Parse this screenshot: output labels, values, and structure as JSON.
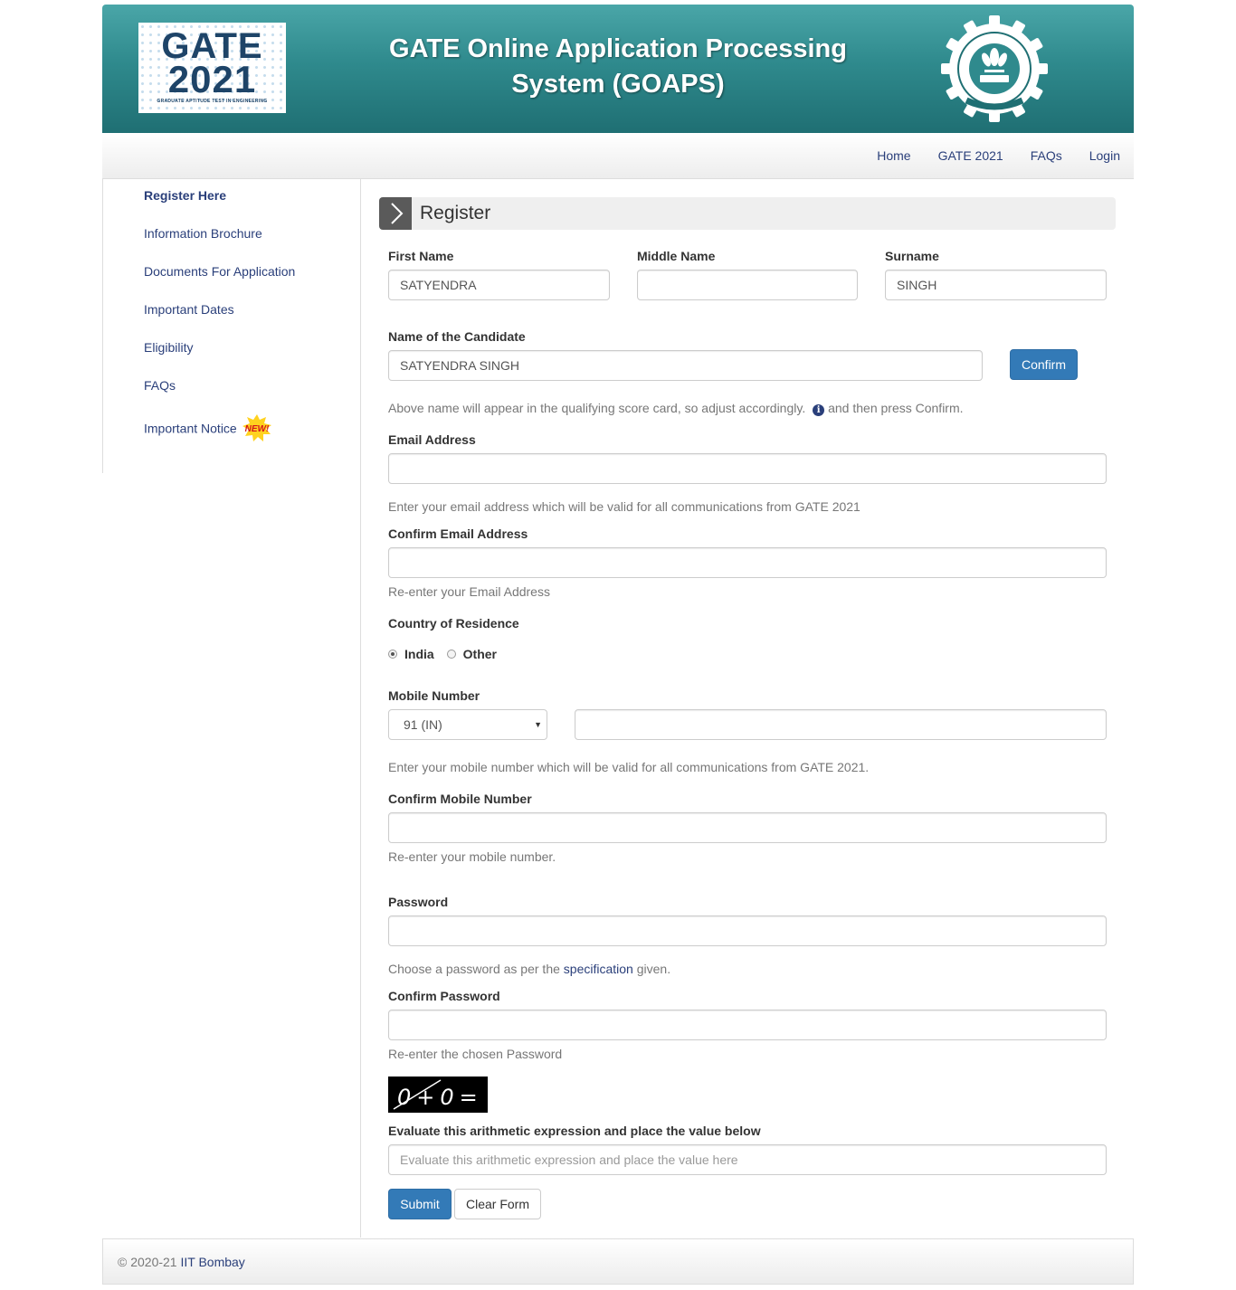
{
  "header": {
    "logo_line1": "GATE",
    "logo_line2": "2021",
    "logo_tagline": "GRADUATE APTITUDE TEST IN ENGINEERING",
    "title_line1": "GATE Online Application Processing",
    "title_line2": "System (GOAPS)"
  },
  "nav": {
    "home": "Home",
    "gate2021": "GATE 2021",
    "faqs": "FAQs",
    "login": "Login"
  },
  "sidebar": {
    "items": [
      "Register Here",
      "Information Brochure",
      "Documents For Application",
      "Important Dates",
      "Eligibility",
      "FAQs",
      "Important Notice"
    ],
    "new_badge": "NEW!"
  },
  "form": {
    "title": "Register",
    "first_name": {
      "label": "First Name",
      "value": "SATYENDRA"
    },
    "middle_name": {
      "label": "Middle Name",
      "value": ""
    },
    "surname": {
      "label": "Surname",
      "value": "SINGH"
    },
    "candidate_name": {
      "label": "Name of the Candidate",
      "value": "SATYENDRA SINGH"
    },
    "confirm_button": "Confirm",
    "name_help_1": "Above name will appear in the qualifying score card, so adjust accordingly.",
    "name_help_2": "and then press Confirm.",
    "email": {
      "label": "Email Address",
      "value": "",
      "help": "Enter your email address which will be valid for all communications from GATE 2021"
    },
    "confirm_email": {
      "label": "Confirm Email Address",
      "value": "",
      "help": "Re-enter your Email Address"
    },
    "country": {
      "label": "Country of Residence",
      "options": [
        "India",
        "Other"
      ],
      "selected": "India"
    },
    "mobile": {
      "label": "Mobile Number",
      "code": "91 (IN)",
      "value": "",
      "help": "Enter your mobile number which will be valid for all communications from GATE 2021."
    },
    "confirm_mobile": {
      "label": "Confirm Mobile Number",
      "value": "",
      "help": "Re-enter your mobile number."
    },
    "password": {
      "label": "Password",
      "help_1": "Choose a password as per the",
      "help_link": "specification",
      "help_2": "given."
    },
    "confirm_password": {
      "label": "Confirm Password",
      "help": "Re-enter the chosen Password"
    },
    "captcha_text": "0+0=",
    "captcha_label": "Evaluate this arithmetic expression and place the value below",
    "captcha_placeholder": "Evaluate this arithmetic expression and place the value here",
    "submit": "Submit",
    "clear": "Clear Form"
  },
  "footer": {
    "copyright": "© 2020-21",
    "link": "IIT Bombay"
  },
  "colors": {
    "header_teal": "#2f8a8d",
    "link": "#2a3f7a",
    "primary_button": "#337ab7"
  }
}
